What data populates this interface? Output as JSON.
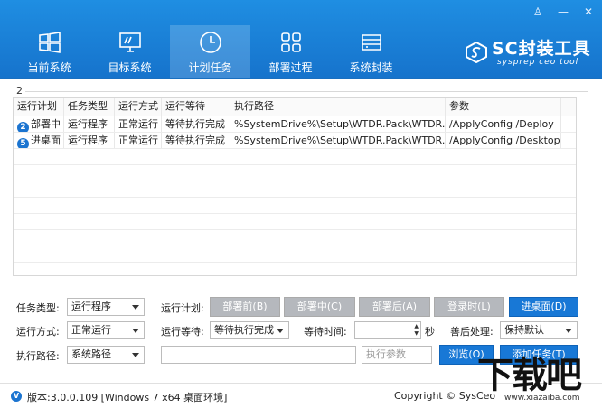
{
  "window": {
    "controls": [
      "♙",
      "—",
      "✕"
    ]
  },
  "tabs": [
    {
      "label": "当前系统",
      "icon": "windows-icon",
      "active": false
    },
    {
      "label": "目标系统",
      "icon": "monitor-icon",
      "active": false
    },
    {
      "label": "计划任务",
      "icon": "clock-icon",
      "active": true
    },
    {
      "label": "部署过程",
      "icon": "grid-icon",
      "active": false
    },
    {
      "label": "系统封装",
      "icon": "drive-icon",
      "active": false
    }
  ],
  "brand": {
    "title": "SC封装工具",
    "subtitle": "sysprep ceo tool"
  },
  "task_count": "2",
  "table": {
    "headers": [
      "运行计划",
      "任务类型",
      "运行方式",
      "运行等待",
      "执行路径",
      "参数"
    ],
    "rows": [
      {
        "badge": "2",
        "plan": "部署中",
        "type": "运行程序",
        "mode": "正常运行",
        "wait": "等待执行完成",
        "path": "%SystemDrive%\\Setup\\WTDR.Pack\\WTDR.Pa...",
        "params": "/ApplyConfig /Deploy"
      },
      {
        "badge": "5",
        "plan": "进桌面",
        "type": "运行程序",
        "mode": "正常运行",
        "wait": "等待执行完成",
        "path": "%SystemDrive%\\Setup\\WTDR.Pack\\WTDR.Pa...",
        "params": "/ApplyConfig /Desktop"
      }
    ]
  },
  "form": {
    "task_type_label": "任务类型:",
    "task_type_value": "运行程序",
    "run_plan_label": "运行计划:",
    "plan_buttons": [
      "部署前(B)",
      "部署中(C)",
      "部署后(A)",
      "登录时(L)",
      "进桌面(D)"
    ],
    "run_mode_label": "运行方式:",
    "run_mode_value": "正常运行",
    "run_wait_label": "运行等待:",
    "run_wait_value": "等待执行完成",
    "wait_time_label": "等待时间:",
    "wait_time_unit": "秒",
    "after_label": "善后处理:",
    "after_value": "保持默认",
    "path_label": "执行路径:",
    "path_value": "系统路径",
    "params_placeholder": "执行参数",
    "browse_label": "浏览(O)",
    "add_label": "添加任务(T)"
  },
  "status": {
    "version_icon": "V",
    "version": "版本:3.0.0.109 [Windows 7 x64 桌面环境]",
    "copyright": "Copyright © SysCeo"
  },
  "watermark": {
    "text": "下载吧",
    "url": "www.xiazaiba.com"
  }
}
